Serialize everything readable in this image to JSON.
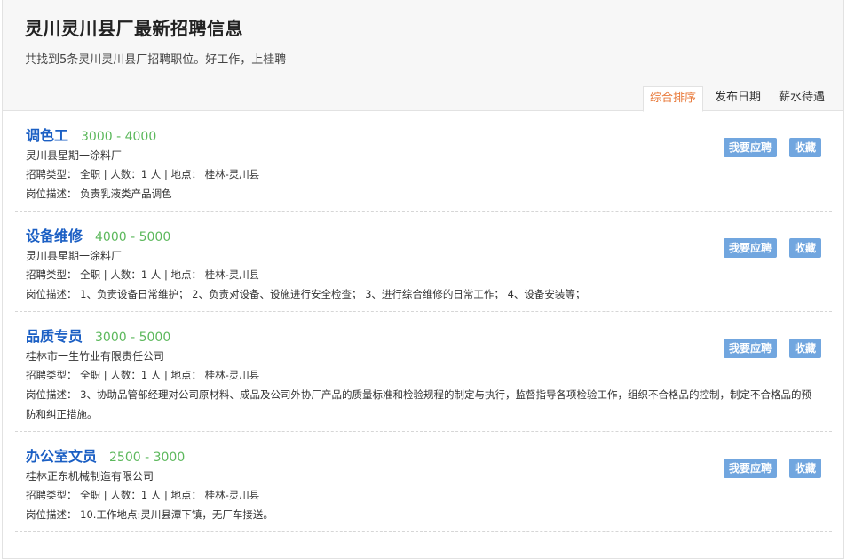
{
  "header": {
    "title": "灵川灵川县厂最新招聘信息",
    "subtitle": "共找到5条灵川灵川县厂招聘职位。好工作，上桂聘"
  },
  "sort_tabs": [
    {
      "label": "综合排序",
      "active": true
    },
    {
      "label": "发布日期",
      "active": false
    },
    {
      "label": "薪水待遇",
      "active": false
    }
  ],
  "actions": {
    "apply_label": "我要应聘",
    "save_label": "收藏"
  },
  "jobs": [
    {
      "title": "调色工",
      "salary": "3000 - 4000",
      "company": "灵川县星期一涂料厂",
      "meta": "招聘类型： 全职 | 人数：1 人 | 地点： 桂林-灵川县",
      "desc": "岗位描述： 负责乳液类产品调色"
    },
    {
      "title": "设备维修",
      "salary": "4000 - 5000",
      "company": "灵川县星期一涂料厂",
      "meta": "招聘类型： 全职 | 人数：1 人 | 地点： 桂林-灵川县",
      "desc": "岗位描述： 1、负责设备日常维护； 2、负责对设备、设施进行安全检查； 3、进行综合维修的日常工作； 4、设备安装等；"
    },
    {
      "title": "品质专员",
      "salary": "3000 - 5000",
      "company": "桂林市一生竹业有限责任公司",
      "meta": "招聘类型： 全职 | 人数：1 人 | 地点： 桂林-灵川县",
      "desc": "岗位描述： 3、协助品管部经理对公司原材料、成品及公司外协厂产品的质量标准和检验规程的制定与执行，监督指导各项检验工作，组织不合格品的控制，制定不合格品的预防和纠正措施。"
    },
    {
      "title": "办公室文员",
      "salary": "2500 - 3000",
      "company": "桂林正东机械制造有限公司",
      "meta": "招聘类型： 全职 | 人数：1 人 | 地点： 桂林-灵川县",
      "desc": "岗位描述： 10.工作地点:灵川县潭下镇，无厂车接送。"
    }
  ]
}
